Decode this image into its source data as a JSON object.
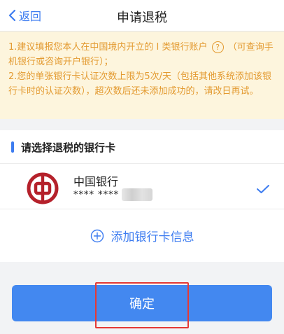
{
  "nav": {
    "back_label": "返回",
    "title": "申请退税"
  },
  "notice": {
    "line1_part1": "1.建议填报您本人在中国境内开立的 I 类银行账户",
    "line1_part2": "（可查询手机银行或咨询开户银行）；",
    "line2": "2.您的单张银行卡认证次数上限为5次/天（包括其他系统添加该银行卡时的认证次数），超次数后还未添加成功的，请改日再试。",
    "help_glyph": "?"
  },
  "section": {
    "title": "请选择退税的银行卡"
  },
  "bank_card": {
    "name": "中国银行",
    "number_masked": "**** ****",
    "selected": true
  },
  "add_card": {
    "label": "添加银行卡信息"
  },
  "confirm": {
    "label": "确定"
  },
  "colors": {
    "accent": "#3d7cf0",
    "notice_text": "#e39a30",
    "notice_bg": "#fdf5dd",
    "bank_red": "#b5212b",
    "highlight": "#e53935"
  }
}
